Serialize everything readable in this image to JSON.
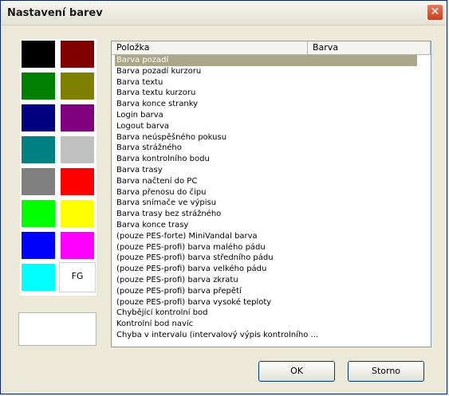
{
  "window": {
    "title": "Nastavení barev",
    "close_glyph": "✕"
  },
  "swatches": [
    {
      "color": "#000000",
      "name": "black"
    },
    {
      "color": "#800000",
      "name": "maroon"
    },
    {
      "color": "#008000",
      "name": "green"
    },
    {
      "color": "#808000",
      "name": "olive"
    },
    {
      "color": "#000080",
      "name": "navy"
    },
    {
      "color": "#800080",
      "name": "purple"
    },
    {
      "color": "#008080",
      "name": "teal"
    },
    {
      "color": "#c0c0c0",
      "name": "silver"
    },
    {
      "color": "#808080",
      "name": "gray"
    },
    {
      "color": "#ff0000",
      "name": "red"
    },
    {
      "color": "#00ff00",
      "name": "lime"
    },
    {
      "color": "#ffff00",
      "name": "yellow"
    },
    {
      "color": "#0000ff",
      "name": "blue"
    },
    {
      "color": "#ff00ff",
      "name": "magenta"
    },
    {
      "color": "#00ffff",
      "name": "cyan"
    },
    {
      "color": "#ffffff",
      "name": "fg",
      "label": "FG"
    }
  ],
  "preview_color": "#ffffff",
  "list": {
    "columns": [
      "Položka",
      "Barva"
    ],
    "selected_index": 0,
    "items": [
      "Barva pozadí",
      "Barva pozadí kurzoru",
      "Barva textu",
      "Barva textu kurzoru",
      "Barva konce stranky",
      "Login barva",
      "Logout barva",
      "Barva neúspěšného pokusu",
      "Barva strážného",
      "Barva kontrolního bodu",
      "Barva trasy",
      "Barva načtení do PC",
      "Barva přenosu do čipu",
      "Barva snímače ve výpisu",
      "Barva trasy bez strážného",
      "Barva konce trasy",
      "(pouze PES-forte) MiniVandal barva",
      "(pouze PES-profi) barva malého pádu",
      "(pouze PES-profi) barva středního pádu",
      "(pouze PES-profi) barva velkého pádu",
      "(pouze PES-profi) barva zkratu",
      "(pouze PES-profi) barva přepětí",
      "(pouze PES-profi) barva vysoké teploty",
      "Chybějící kontrolní bod",
      "Kontrolní bod navíc",
      "Chyba v intervalu (intervalový výpis kontrolního ..."
    ]
  },
  "buttons": {
    "ok": "OK",
    "cancel": "Storno"
  }
}
